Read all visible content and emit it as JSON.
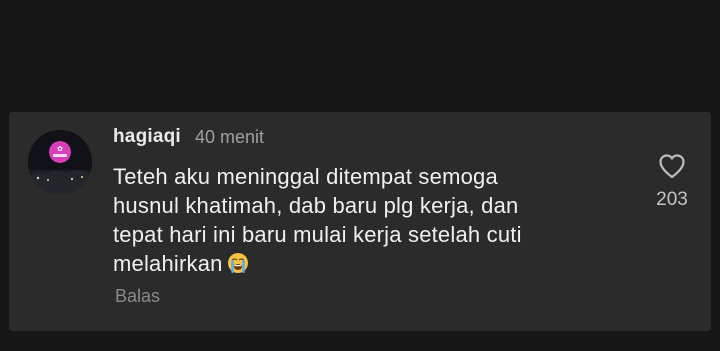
{
  "comment": {
    "username": "hagiaqi",
    "time": "40 menit",
    "text_lines": [
      "Teteh aku meninggal ditempat semoga",
      "husnul khatimah, dab baru plg kerja, dan",
      "tepat hari ini baru mulai kerja setelah cuti",
      "melahirkan"
    ],
    "emoji": "loudly-crying-face",
    "reply_label": "Balas",
    "like_icon": "heart-outline-icon",
    "like_count": "203"
  },
  "colors": {
    "background": "#161616",
    "card": "#2b2b2b",
    "text_primary": "#f0f0f0",
    "text_secondary": "#a0a0a0",
    "avatar_accent": "#d63fb8"
  }
}
